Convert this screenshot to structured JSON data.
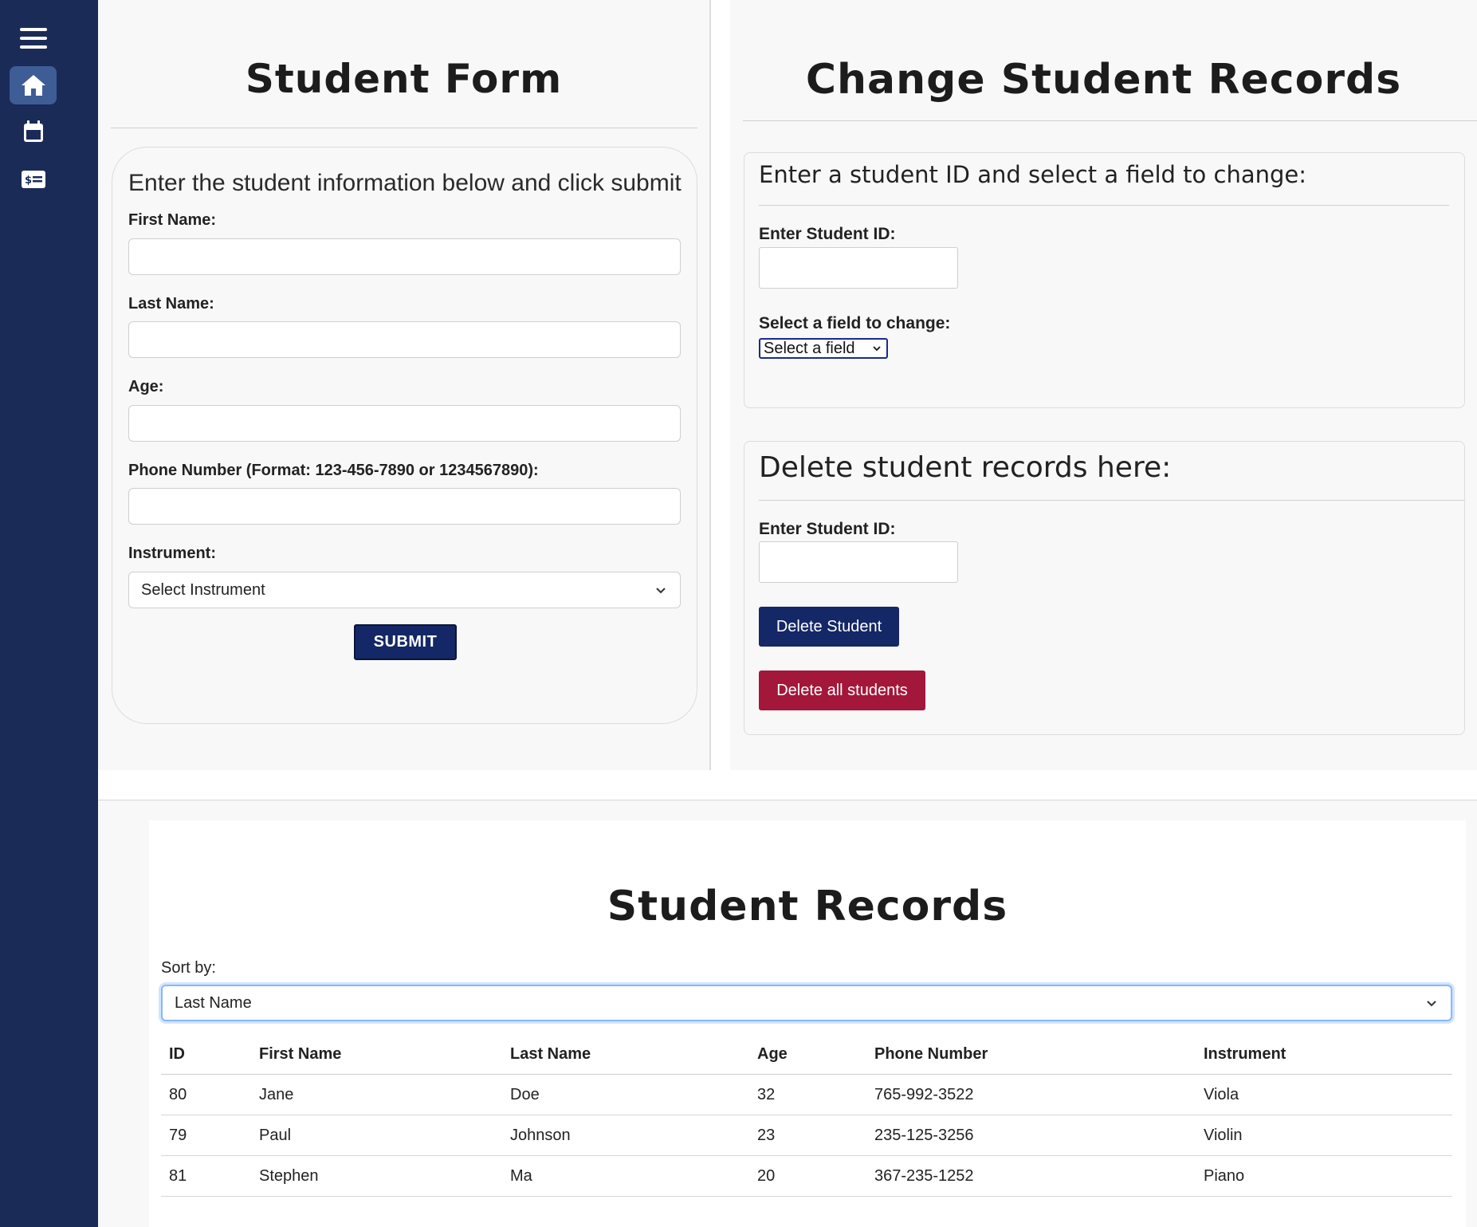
{
  "sidebar": {
    "items": [
      {
        "icon": "menu-icon"
      },
      {
        "icon": "home-icon",
        "active": true
      },
      {
        "icon": "calendar-icon"
      },
      {
        "icon": "payment-card-icon"
      }
    ],
    "active_color": "#3e5d97",
    "background": "#1a2b57"
  },
  "student_form": {
    "title": "Student Form",
    "intro": "Enter the student information below and click submit",
    "first_name_label": "First Name:",
    "first_name_value": "",
    "last_name_label": "Last Name:",
    "last_name_value": "",
    "age_label": "Age:",
    "age_value": "",
    "phone_label": "Phone Number (Format: 123-456-7890 or 1234567890):",
    "phone_value": "",
    "instrument_label": "Instrument:",
    "instrument_selected": "Select Instrument",
    "submit_label": "SUBMIT"
  },
  "change_records": {
    "title": "Change Student Records",
    "change_panel": {
      "heading": "Enter a student ID and select a field to change:",
      "id_label": "Enter Student ID:",
      "id_value": "",
      "field_label": "Select a field to change:",
      "field_selected": "Select a field"
    },
    "delete_panel": {
      "heading": "Delete student records here:",
      "id_label": "Enter Student ID:",
      "id_value": "",
      "delete_button": "Delete Student",
      "delete_all_button": "Delete all students"
    }
  },
  "records": {
    "title": "Student Records",
    "sort_label": "Sort by:",
    "sort_selected": "Last Name",
    "columns": [
      "ID",
      "First Name",
      "Last Name",
      "Age",
      "Phone Number",
      "Instrument"
    ],
    "rows": [
      [
        "80",
        "Jane",
        "Doe",
        "32",
        "765-992-3522",
        "Viola"
      ],
      [
        "79",
        "Paul",
        "Johnson",
        "23",
        "235-125-3256",
        "Violin"
      ],
      [
        "81",
        "Stephen",
        "Ma",
        "20",
        "367-235-1252",
        "Piano"
      ]
    ]
  },
  "colors": {
    "primary_button": "#142766",
    "danger_button": "#a3173a"
  }
}
